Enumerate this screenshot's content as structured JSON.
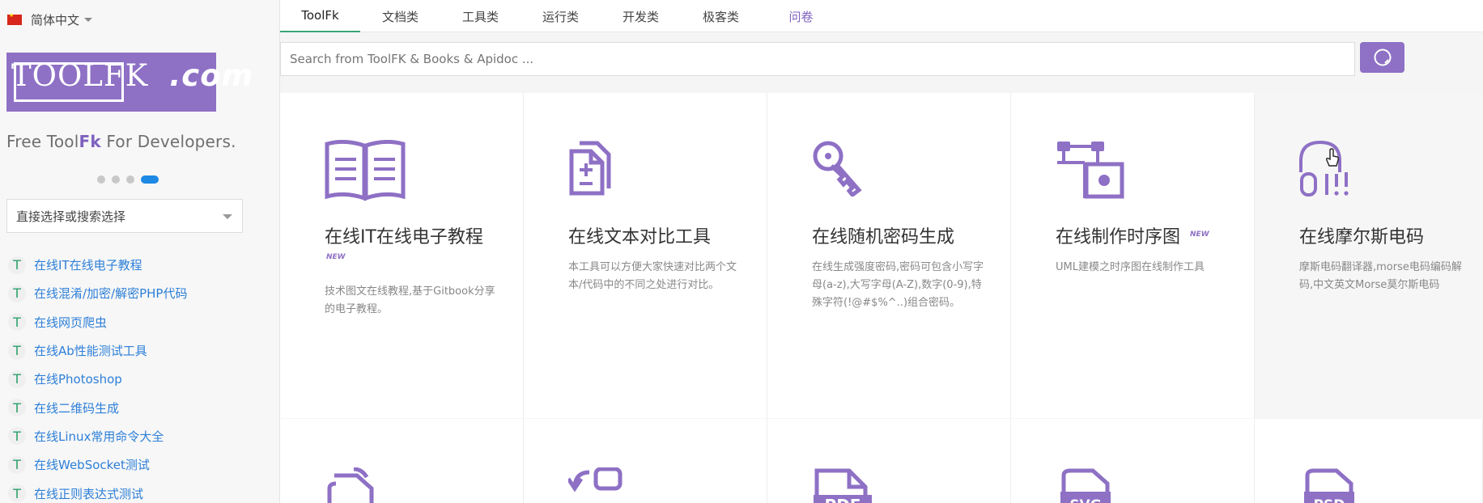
{
  "language": {
    "label": "简体中文"
  },
  "logo": {
    "text": "TOOLFK",
    "suffix": ".com"
  },
  "tagline": {
    "prefix": "Free Tool",
    "highlight": "Fk",
    "suffix": " For Developers."
  },
  "carousel": {
    "count": 4,
    "active_index": 4
  },
  "tool_select": {
    "placeholder": "直接选择或搜索选择"
  },
  "sidebar": {
    "marker": "T",
    "items": [
      "在线IT在线电子教程",
      "在线混淆/加密/解密PHP代码",
      "在线网页爬虫",
      "在线Ab性能测试工具",
      "在线Photoshop",
      "在线二维码生成",
      "在线Linux常用命令大全",
      "在线WebSocket测试",
      "在线正则表达式测试"
    ]
  },
  "topnav": {
    "tabs": [
      "ToolFk",
      "文档类",
      "工具类",
      "运行类",
      "开发类",
      "极客类",
      "问卷"
    ],
    "active": "ToolFk"
  },
  "search": {
    "placeholder": "Search from ToolFK & Books & Apidoc ..."
  },
  "cards": [
    {
      "title": "在线IT在线电子教程",
      "badge": "NEW",
      "desc": "技术图文在线教程,基于Gitbook分享的电子教程。",
      "icon": "book-icon"
    },
    {
      "title": "在线文本对比工具",
      "desc": "本工具可以方便大家快速对比两个文本/代码中的不同之处进行对比。",
      "icon": "document-compare-icon"
    },
    {
      "title": "在线随机密码生成",
      "desc": "在线生成强度密码,密码可包含小写字母(a-z),大写字母(A-Z),数字(0-9),特殊字符(!@#$%^..)组合密码。",
      "icon": "key-icon"
    },
    {
      "title": "在线制作时序图",
      "badge": "NEW",
      "desc": "UML建模之时序图在线制作工具",
      "icon": "sequence-diagram-icon"
    },
    {
      "title": "在线摩尔斯电码",
      "desc": "摩斯电码翻译器,morse电码编码解码,中文英文Morse莫尔斯电码",
      "icon": "morse-icon"
    }
  ],
  "second_row_icons": [
    "file-icon",
    "refresh-icon",
    "pdf-file-icon",
    "svg-file-icon",
    "psd-file-icon"
  ],
  "colors": {
    "brand": "#8e70c5",
    "link": "#2d7fd8",
    "active_tab": "#3aa57a"
  }
}
